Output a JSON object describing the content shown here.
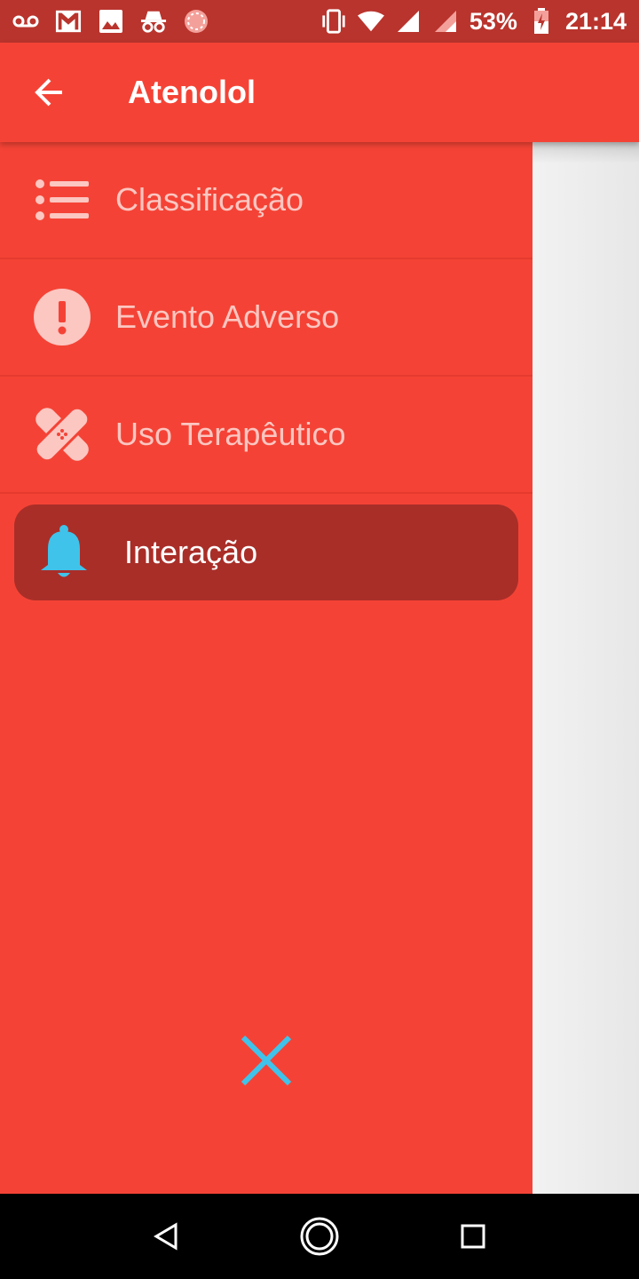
{
  "status_bar": {
    "battery": "53%",
    "time": "21:14",
    "icons_left": [
      "voicemail-icon",
      "gmail-icon",
      "image-icon",
      "incognito-icon",
      "pinwheel-icon"
    ],
    "icons_right": [
      "vibrate-icon",
      "wifi-icon",
      "signal-icon",
      "signal-icon",
      "battery-icon"
    ]
  },
  "app_bar": {
    "title": "Atenolol",
    "back_icon": "arrow-left-icon"
  },
  "drawer": {
    "items": [
      {
        "label": "Classificação",
        "icon": "list-icon",
        "active": false
      },
      {
        "label": "Evento Adverso",
        "icon": "alert-circle-icon",
        "active": false
      },
      {
        "label": "Uso Terapêutico",
        "icon": "bandage-icon",
        "active": false
      },
      {
        "label": "Interação",
        "icon": "bell-icon",
        "active": true
      }
    ],
    "close_icon": "close-icon"
  },
  "colors": {
    "primary": "#f44336",
    "status_bar": "#b9342d",
    "active_item_bg": "#a92e28",
    "inactive_text": "#fcc6c1",
    "accent": "#3fc3ea"
  },
  "nav_bar": {
    "buttons": [
      "back-triangle-icon",
      "home-circle-icon",
      "recents-square-icon"
    ]
  }
}
